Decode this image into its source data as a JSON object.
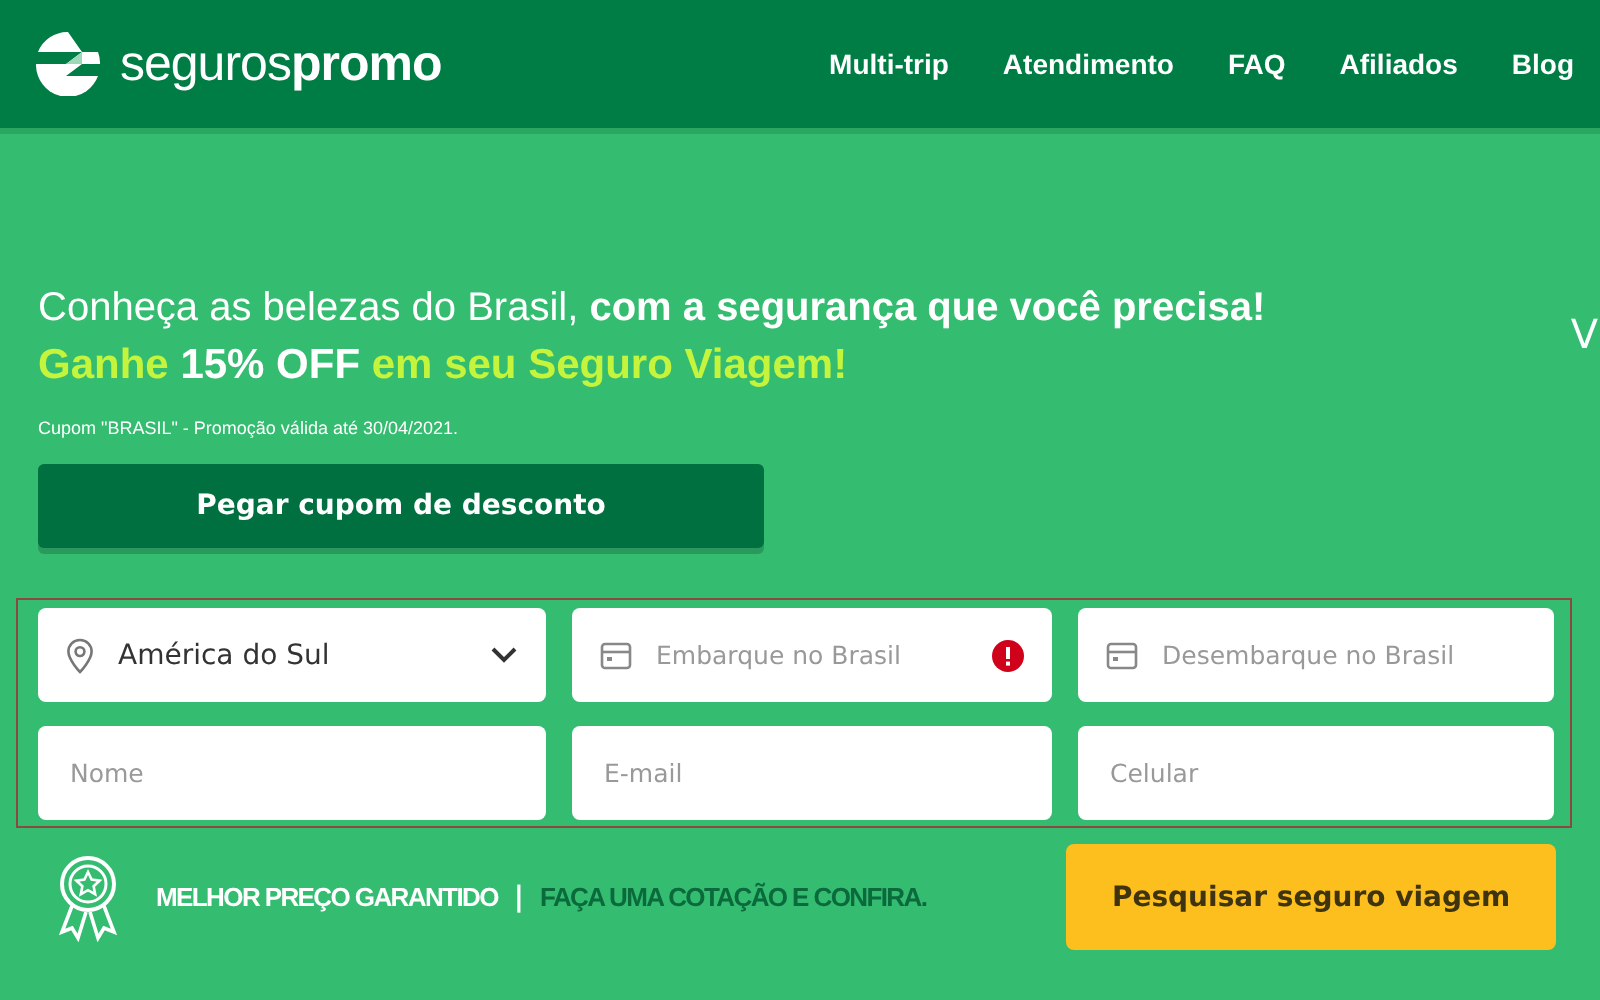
{
  "header": {
    "logo": "seguros**promo**",
    "nav": [
      {
        "label": "Multi-trip"
      },
      {
        "label": "Atendimento"
      },
      {
        "label": "FAQ"
      },
      {
        "label": "Afiliados"
      },
      {
        "label": "Blog"
      }
    ]
  },
  "hero": {
    "headline": "Conheça as belezas do Brasil, **com a segurança que você precisa!**",
    "promo": [
      {
        "text": "Ganhe ",
        "highlight": true
      },
      {
        "text": "15% OFF",
        "highlight": false
      },
      {
        "text": " em seu Seguro Viagem!",
        "highlight": true
      }
    ],
    "note": "Cupom \"BRASIL\" - Promoção válida até 30/04/2021.",
    "coupon_button": "Pegar cupom de desconto",
    "side_text": "V"
  },
  "form": {
    "fields": [
      {
        "kind": "select",
        "value": "América do Sul"
      },
      {
        "kind": "date",
        "placeholder": "Embarque no Brasil",
        "error": true
      },
      {
        "kind": "date",
        "placeholder": "Desembarque no Brasil",
        "error": false
      },
      {
        "kind": "text",
        "placeholder": "Nome"
      },
      {
        "kind": "text",
        "placeholder": "E-mail"
      },
      {
        "kind": "text",
        "placeholder": "Celular"
      }
    ]
  },
  "footer": {
    "guarantee": "MELHOR PREÇO GARANTIDO",
    "separator": "|",
    "tagline": "FAÇA UMA COTAÇÃO E CONFIRA.",
    "search_button": "Pesquisar seguro viagem"
  }
}
